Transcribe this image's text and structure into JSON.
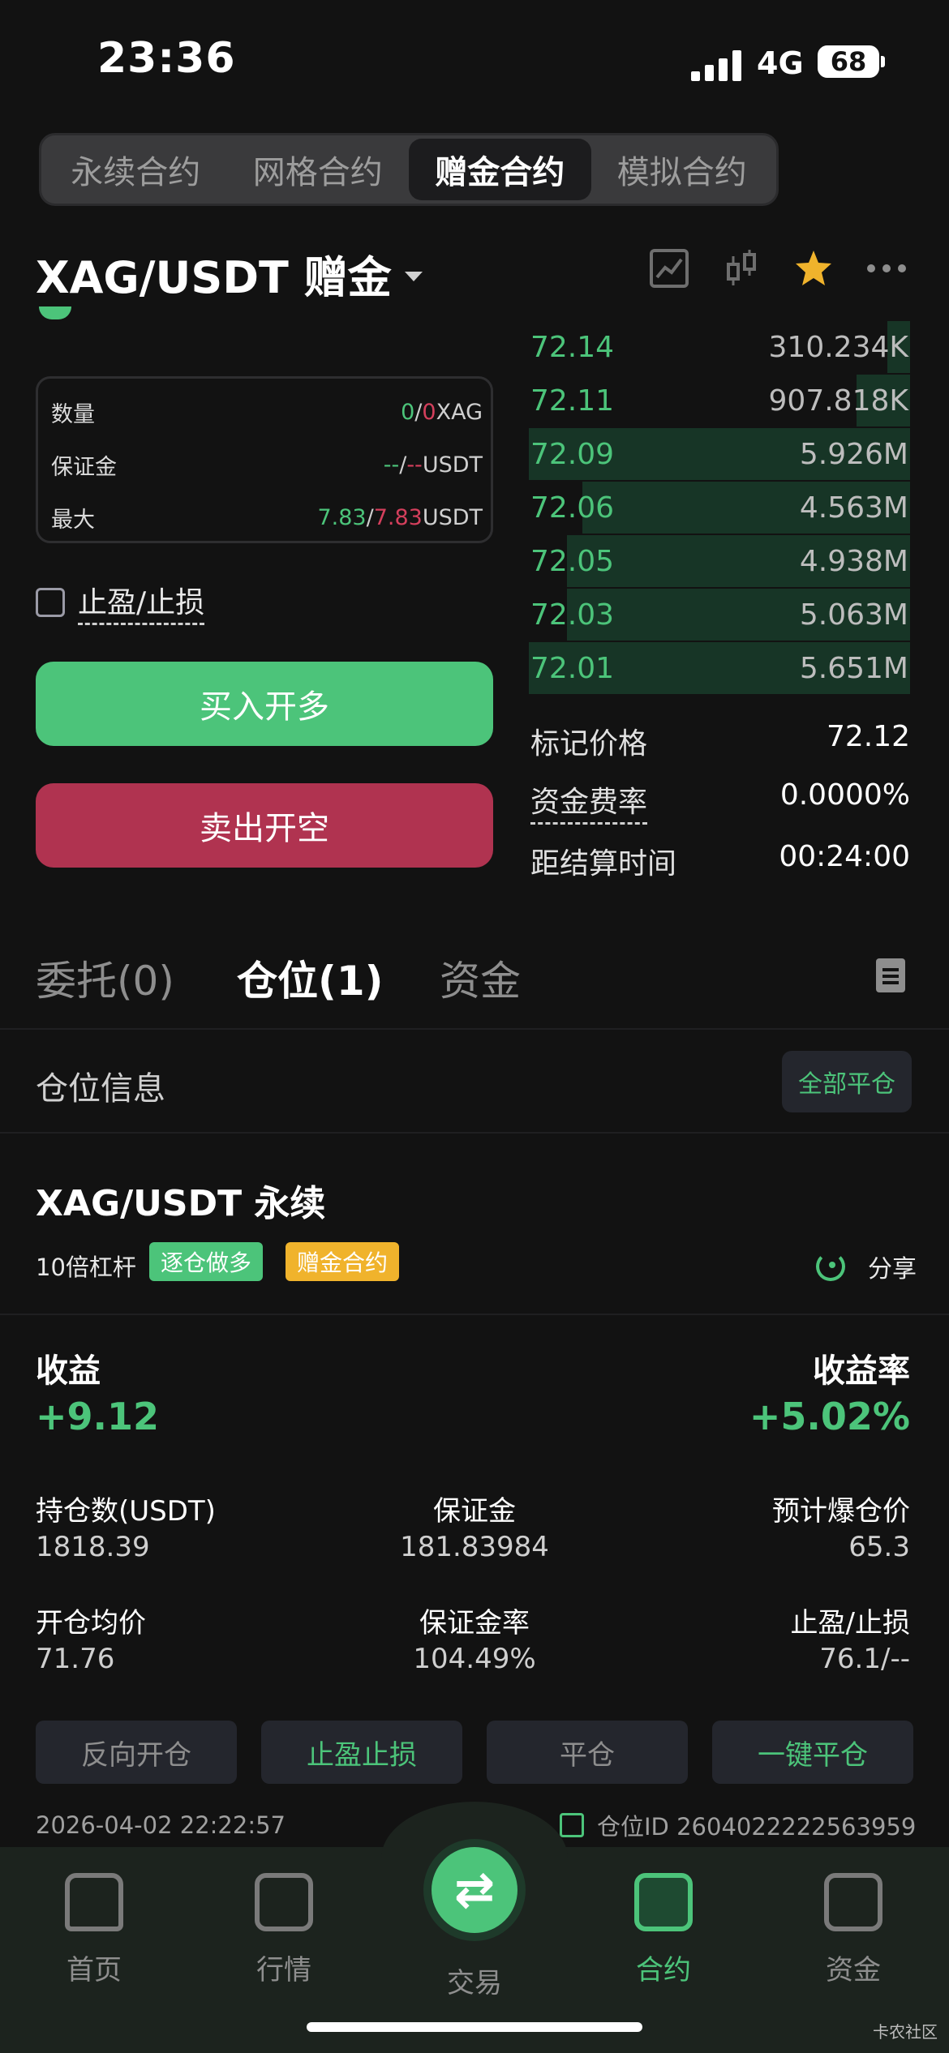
{
  "status_bar": {
    "time": "23:36",
    "network": "4G",
    "battery": "68"
  },
  "contract_tabs": [
    {
      "label": "永续合约",
      "active": false
    },
    {
      "label": "网格合约",
      "active": false
    },
    {
      "label": "赠金合约",
      "active": true
    },
    {
      "label": "模拟合约",
      "active": false
    }
  ],
  "pair": {
    "title": "XAG/USDT 赠金"
  },
  "header_icons": [
    "chart-icon",
    "candlestick-icon",
    "star-icon",
    "more-icon"
  ],
  "form": {
    "rows": [
      {
        "label": "数量",
        "a": "0",
        "sep": "/",
        "b": "0",
        "unit": "XAG"
      },
      {
        "label": "保证金",
        "a": "--",
        "sep": "/",
        "b": "--",
        "unit": "USDT"
      },
      {
        "label": "最大",
        "a": "7.83",
        "sep": "/",
        "b": "7.83",
        "unit": "USDT"
      }
    ],
    "tpsl_label": "止盈/止损",
    "buy_label": "买入开多",
    "sell_label": "卖出开空"
  },
  "order_book": [
    {
      "price": "72.14",
      "qty": "310.234K",
      "depth": 0.06
    },
    {
      "price": "72.11",
      "qty": "907.818K",
      "depth": 0.14
    },
    {
      "price": "72.09",
      "qty": "5.926M",
      "depth": 1.0
    },
    {
      "price": "72.06",
      "qty": "4.563M",
      "depth": 0.86
    },
    {
      "price": "72.05",
      "qty": "4.938M",
      "depth": 0.9
    },
    {
      "price": "72.03",
      "qty": "5.063M",
      "depth": 0.9
    },
    {
      "price": "72.01",
      "qty": "5.651M",
      "depth": 1.0
    }
  ],
  "market_info": [
    {
      "label": "标记价格",
      "value": "72.12"
    },
    {
      "label": "资金费率",
      "value": "0.0000%"
    },
    {
      "label": "距结算时间",
      "value": "00:24:00"
    }
  ],
  "position_tabs": [
    {
      "label": "委托(0)",
      "active": false
    },
    {
      "label": "仓位(1)",
      "active": true
    },
    {
      "label": "资金",
      "active": false
    }
  ],
  "position_section": {
    "title": "仓位信息",
    "close_all": "全部平仓"
  },
  "position": {
    "name": "XAG/USDT 永续",
    "leverage": "10倍杠杆",
    "tag_mode": "逐仓做多",
    "tag_type": "赠金合约",
    "share": "分享",
    "pnl_label": "收益",
    "pnl_value": "+9.12",
    "roe_label": "收益率",
    "roe_value": "+5.02%",
    "stats": {
      "size_label": "持仓数(USDT)",
      "size_value": "1818.39",
      "margin_label": "保证金",
      "margin_value": "181.83984",
      "liq_label": "预计爆仓价",
      "liq_value": "65.3",
      "entry_label": "开仓均价",
      "entry_value": "71.76",
      "margin_ratio_label": "保证金率",
      "margin_ratio_value": "104.49%",
      "tpsl_label": "止盈/止损",
      "tpsl_value": "76.1/--"
    },
    "actions": [
      "反向开仓",
      "止盈止损",
      "平仓",
      "一键平仓"
    ],
    "timestamp": "2026-04-02 22:22:57",
    "position_id": "仓位ID 2604022222563959"
  },
  "bottom_nav": [
    {
      "label": "首页",
      "icon": "home-icon",
      "active": false
    },
    {
      "label": "行情",
      "icon": "market-icon",
      "active": false
    },
    {
      "label": "交易",
      "icon": "swap-icon",
      "active": false
    },
    {
      "label": "合约",
      "icon": "contract-icon",
      "active": true
    },
    {
      "label": "资金",
      "icon": "wallet-icon",
      "active": false
    }
  ],
  "watermark": "卡农社区",
  "colors": {
    "green": "#4cc47a",
    "red": "#b03350",
    "yellow": "#f0b32c",
    "background": "#121212"
  }
}
